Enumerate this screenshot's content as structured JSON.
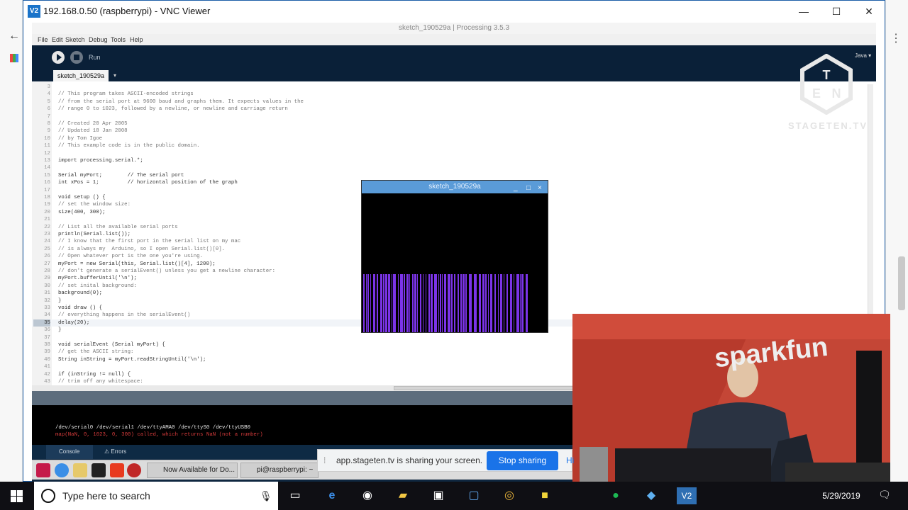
{
  "vnc": {
    "title": "192.168.0.50 (raspberrypi) - VNC Viewer",
    "logo": "V2",
    "minimize": "—",
    "maximize": "☐",
    "close": "✕"
  },
  "processing": {
    "window_title": "sketch_190529a | Processing 3.5.3",
    "menu": [
      "File",
      "Edit",
      "Sketch",
      "Debug",
      "Tools",
      "Help"
    ],
    "run_label": "Run",
    "tab_name": "sketch_190529a",
    "mode": "Java ▾",
    "code": [
      {
        "n": "3",
        "t": "",
        "c": false
      },
      {
        "n": "4",
        "t": "// This program takes ASCII-encoded strings",
        "c": true
      },
      {
        "n": "5",
        "t": "// from the serial port at 9600 baud and graphs them. It expects values in the",
        "c": true
      },
      {
        "n": "6",
        "t": "// range 0 to 1023, followed by a newline, or newline and carriage return",
        "c": true
      },
      {
        "n": "7",
        "t": "",
        "c": false
      },
      {
        "n": "8",
        "t": "// Created 20 Apr 2005",
        "c": true
      },
      {
        "n": "9",
        "t": "// Updated 18 Jan 2008",
        "c": true
      },
      {
        "n": "10",
        "t": "// by Tom Igoe",
        "c": true
      },
      {
        "n": "11",
        "t": "// This example code is in the public domain.",
        "c": true
      },
      {
        "n": "12",
        "t": "",
        "c": false
      },
      {
        "n": "13",
        "t": "import processing.serial.*;",
        "c": false
      },
      {
        "n": "14",
        "t": "",
        "c": false
      },
      {
        "n": "15",
        "t": "Serial myPort;        // The serial port",
        "c": false
      },
      {
        "n": "16",
        "t": "int xPos = 1;         // horizontal position of the graph",
        "c": false
      },
      {
        "n": "17",
        "t": "",
        "c": false
      },
      {
        "n": "18",
        "t": "void setup () {",
        "c": false
      },
      {
        "n": "19",
        "t": "// set the window size:",
        "c": true
      },
      {
        "n": "20",
        "t": "size(400, 300);",
        "c": false
      },
      {
        "n": "21",
        "t": "",
        "c": false
      },
      {
        "n": "22",
        "t": "// List all the available serial ports",
        "c": true
      },
      {
        "n": "23",
        "t": "println(Serial.list());",
        "c": false
      },
      {
        "n": "24",
        "t": "// I know that the first port in the serial list on my mac",
        "c": true
      },
      {
        "n": "25",
        "t": "// is always my  Arduino, so I open Serial.list()[0].",
        "c": true
      },
      {
        "n": "26",
        "t": "// Open whatever port is the one you're using.",
        "c": true
      },
      {
        "n": "27",
        "t": "myPort = new Serial(this, Serial.list()[4], 1200);",
        "c": false
      },
      {
        "n": "28",
        "t": "// don't generate a serialEvent() unless you get a newline character:",
        "c": true
      },
      {
        "n": "29",
        "t": "myPort.bufferUntil('\\n');",
        "c": false
      },
      {
        "n": "30",
        "t": "// set inital background:",
        "c": true
      },
      {
        "n": "31",
        "t": "background(0);",
        "c": false
      },
      {
        "n": "32",
        "t": "}",
        "c": false
      },
      {
        "n": "33",
        "t": "void draw () {",
        "c": false
      },
      {
        "n": "34",
        "t": "// everything happens in the serialEvent()",
        "c": true
      },
      {
        "n": "35",
        "t": "delay(20);",
        "c": false,
        "hl": true
      },
      {
        "n": "36",
        "t": "}",
        "c": false
      },
      {
        "n": "37",
        "t": "",
        "c": false
      },
      {
        "n": "38",
        "t": "void serialEvent (Serial myPort) {",
        "c": false
      },
      {
        "n": "39",
        "t": "// get the ASCII string:",
        "c": true
      },
      {
        "n": "40",
        "t": "String inString = myPort.readStringUntil('\\n');",
        "c": false
      },
      {
        "n": "41",
        "t": "",
        "c": false
      },
      {
        "n": "42",
        "t": "if (inString != null) {",
        "c": false
      },
      {
        "n": "43",
        "t": "// trim off any whitespace:",
        "c": true
      }
    ],
    "console_lines": [
      {
        "t": "/dev/serial0 /dev/serial1 /dev/ttyAMA0 /dev/ttyS0 /dev/ttyUSB0",
        "color": "#e8e8e8"
      },
      {
        "t": "map(NaN, 0, 1023, 0, 300) called, which returns NaN (not a number)",
        "color": "#d43b3b"
      }
    ],
    "console_tab": "Console",
    "errors_tab": "Errors"
  },
  "sketch_window": {
    "title": "sketch_190529a",
    "minimize": "_",
    "maximize": "□",
    "close": "×",
    "bar_color": "#7b34e8",
    "graph_level": 0.28
  },
  "pi_taskbar": {
    "task1": "Now Available for Do...",
    "task2": "pi@raspberrypi: ~"
  },
  "watermark": "STAGETEN.TV",
  "share_bar": {
    "message": "app.stageten.tv is sharing your screen.",
    "stop_button": "Stop sharing",
    "hide": "Hi"
  },
  "webcam": {
    "sign": "sparkfun"
  },
  "windows": {
    "search_placeholder": "Type here to search",
    "date": "5/29/2019"
  },
  "colors": {
    "accent": "#1a73e8",
    "processing_bg": "#0f2740",
    "wall": "#c64334"
  }
}
